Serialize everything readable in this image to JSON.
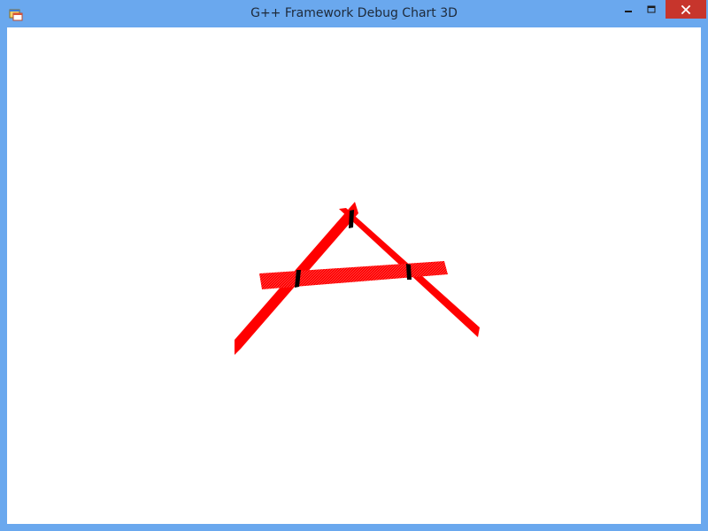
{
  "window": {
    "title": "G++ Framework Debug Chart 3D",
    "frame_color": "#6aa8ee",
    "close_button_color": "#c7352c",
    "icons": {
      "app": "app-window-icon",
      "minimize": "minimize-icon",
      "maximize": "maximize-icon",
      "close": "close-icon"
    }
  },
  "scene": {
    "ribbon_color": "#ff0000",
    "marker_color": "#000000",
    "background": "#ffffff"
  }
}
